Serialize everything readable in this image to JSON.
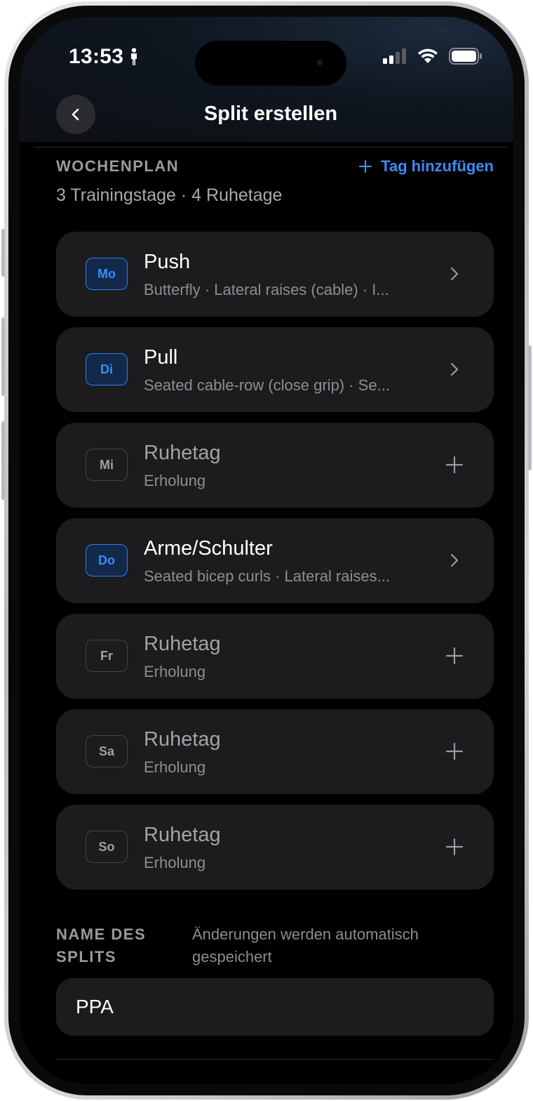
{
  "status_bar": {
    "time": "13:53"
  },
  "nav": {
    "title": "Split erstellen"
  },
  "week_plan": {
    "section_label": "WOCHENPLAN",
    "add_day_label": "Tag hinzufügen",
    "summary": "3 Trainingstage · 4 Ruhetage",
    "days": [
      {
        "abbr": "Mo",
        "title": "Push",
        "subtitle": "Butterfly · Lateral raises (cable) · I...",
        "type": "training"
      },
      {
        "abbr": "Di",
        "title": "Pull",
        "subtitle": "Seated cable-row (close grip) · Se...",
        "type": "training"
      },
      {
        "abbr": "Mi",
        "title": "Ruhetag",
        "subtitle": "Erholung",
        "type": "rest"
      },
      {
        "abbr": "Do",
        "title": "Arme/Schulter",
        "subtitle": "Seated bicep curls · Lateral raises...",
        "type": "training"
      },
      {
        "abbr": "Fr",
        "title": "Ruhetag",
        "subtitle": "Erholung",
        "type": "rest"
      },
      {
        "abbr": "Sa",
        "title": "Ruhetag",
        "subtitle": "Erholung",
        "type": "rest"
      },
      {
        "abbr": "So",
        "title": "Ruhetag",
        "subtitle": "Erholung",
        "type": "rest"
      }
    ]
  },
  "split_name": {
    "label": "NAME DES SPLITS",
    "hint": "Änderungen werden automatisch gespeichert",
    "value": "PPA"
  },
  "icons": {
    "back": "chevron-left-icon",
    "add_day": "plus-icon",
    "training_action": "chevron-right-icon",
    "rest_action": "plus-icon"
  },
  "colors": {
    "accent": "#3d8bf2",
    "card_bg": "#1c1c1e",
    "background": "#000000"
  }
}
